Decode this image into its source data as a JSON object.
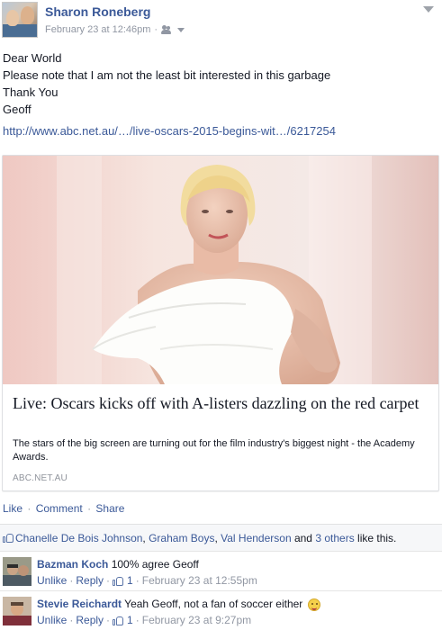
{
  "post": {
    "author": "Sharon Roneberg",
    "timestamp": "February 23 at 12:46pm",
    "meta_separator": "·",
    "privacy_icon": "friends-icon",
    "text_lines": [
      "Dear World",
      "Please note that I am not the least bit interested in this garbage",
      "Thank You",
      "Geoff"
    ],
    "url": "http://www.abc.net.au/…/live-oscars-2015-begins-wit…/6217254"
  },
  "share_card": {
    "title": "Live: Oscars kicks off with A-listers dazzling on the red carpet",
    "description": "The stars of the big screen are turning out for the film industry's biggest night - the Academy Awards.",
    "domain": "ABC.NET.AU"
  },
  "actions": {
    "like": "Like",
    "comment": "Comment",
    "share": "Share",
    "separator": "·"
  },
  "likes": {
    "name1": "Chanelle De Bois Johnson",
    "sep1": ", ",
    "name2": "Graham Boys",
    "sep2": ", ",
    "name3": "Val Henderson",
    "conj": " and ",
    "others": "3 others",
    "suffix": " like this."
  },
  "comments": [
    {
      "author": "Bazman Koch",
      "text": "100% agree Geoff",
      "unlike": "Unlike",
      "reply": "Reply",
      "like_count": "1",
      "timestamp": "February 23 at 12:55pm",
      "separator": "·"
    },
    {
      "author": "Stevie Reichardt",
      "text": "Yeah Geoff, not a fan of soccer either",
      "emoji": "grinning-emoji-icon",
      "unlike": "Unlike",
      "reply": "Reply",
      "like_count": "1",
      "timestamp": "February 23 at 9:27pm",
      "separator": "·"
    }
  ],
  "colors": {
    "link": "#3b5998",
    "meta": "#9197a3",
    "text": "#141823"
  }
}
